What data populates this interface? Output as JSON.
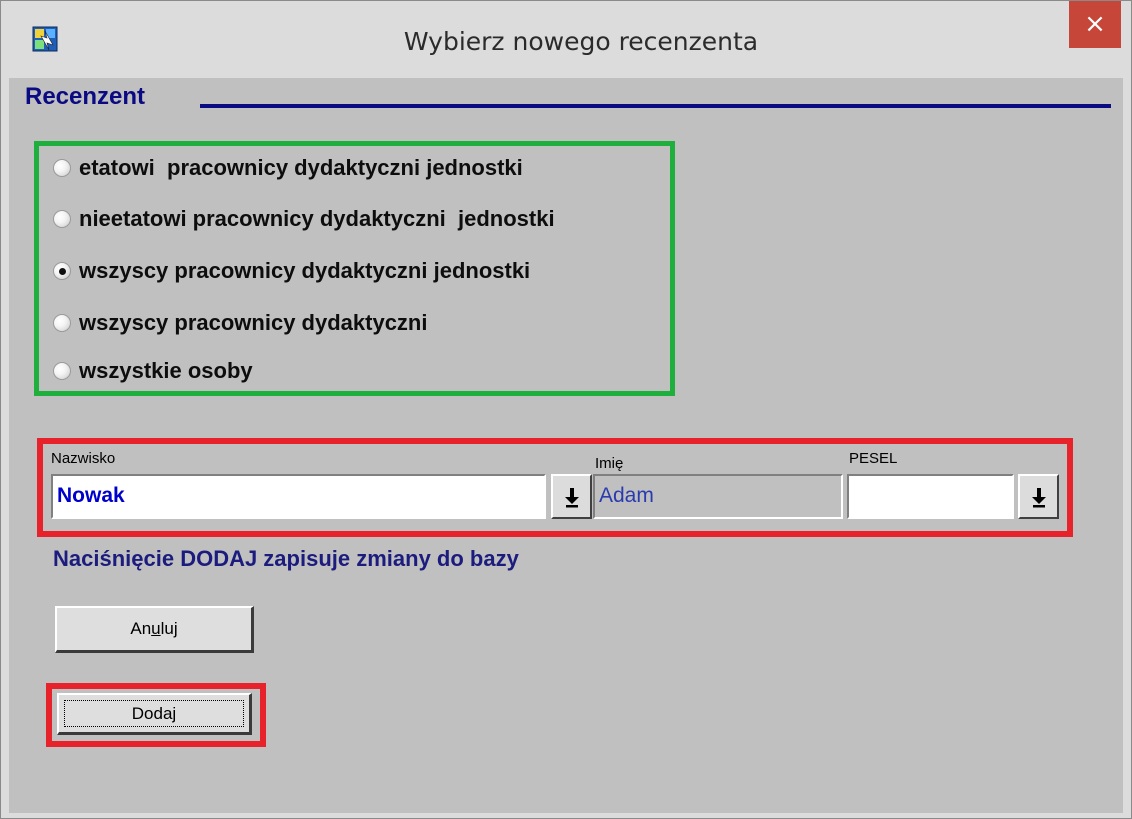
{
  "window": {
    "title": "Wybierz nowego recenzenta",
    "close_glyph": "×"
  },
  "section": {
    "title": "Recenzent"
  },
  "radio_options": [
    {
      "label": "etatowi  pracownicy dydaktyczni jednostki",
      "checked": false
    },
    {
      "label": "nieetatowi pracownicy dydaktyczni  jednostki",
      "checked": false
    },
    {
      "label": "wszyscy pracownicy dydaktyczni jednostki",
      "checked": true
    },
    {
      "label": "wszyscy pracownicy dydaktyczni",
      "checked": false
    },
    {
      "label": "wszystkie osoby",
      "checked": false
    }
  ],
  "fields": {
    "nazwisko": {
      "label": "Nazwisko",
      "value": "Nowak"
    },
    "imie": {
      "label": "Imię",
      "value": "Adam"
    },
    "pesel": {
      "label": "PESEL",
      "value": ""
    }
  },
  "info_text": "Naciśnięcie DODAJ zapisuje zmiany do bazy",
  "buttons": {
    "cancel_label_pre": "An",
    "cancel_label_mnemonic": "u",
    "cancel_label_post": "luj",
    "add_label": "Dodaj"
  },
  "colors": {
    "accent_text": "#0a0a82",
    "highlight_green": "#1eaf3c",
    "highlight_red": "#e8222a",
    "close_button": "#c7463a"
  },
  "icons": {
    "app": "app-icon",
    "close": "close-icon",
    "dropdown": "arrow-down-icon"
  }
}
